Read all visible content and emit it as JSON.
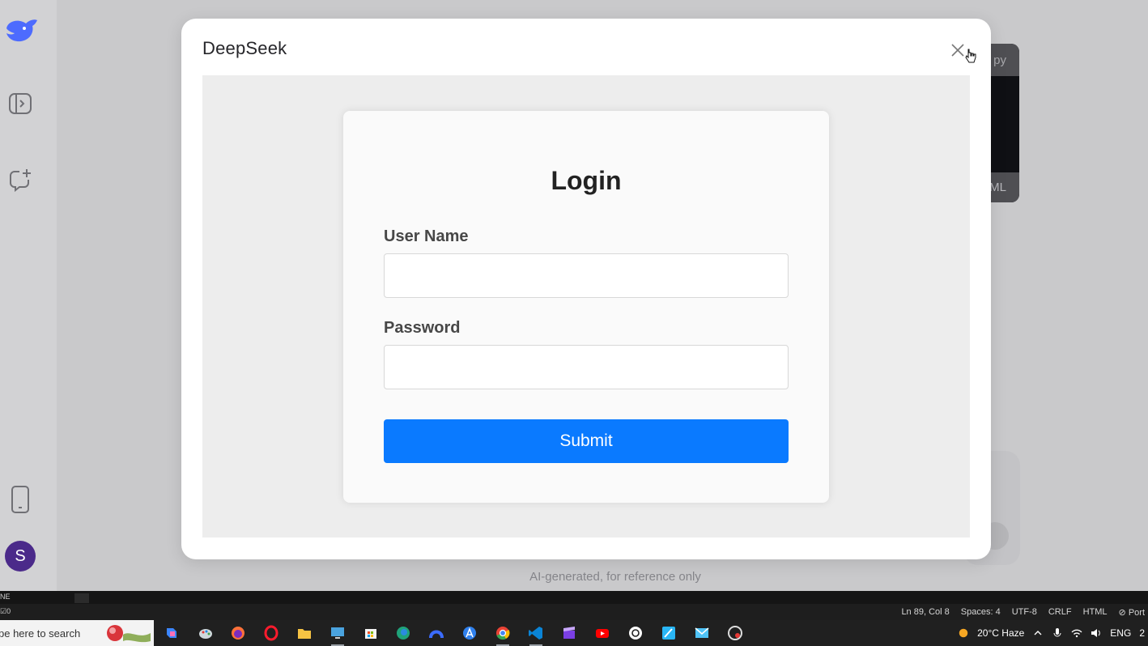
{
  "modal": {
    "title": "DeepSeek",
    "login": {
      "title": "Login",
      "username_label": "User Name",
      "username_value": "",
      "password_label": "Password",
      "password_value": "",
      "submit_label": "Submit"
    }
  },
  "background": {
    "disclaimer": "AI-generated, for reference only",
    "code_panel_head": "py",
    "code_panel_foot": "ML",
    "avatar_letter": "S"
  },
  "status_bar": {
    "left_top": "NE",
    "left_bottom": "☑0",
    "position": "Ln 89, Col 8",
    "spaces": "Spaces: 4",
    "encoding": "UTF-8",
    "eol": "CRLF",
    "language": "HTML",
    "port": "⊘ Port"
  },
  "taskbar": {
    "search_text": "pe here to search",
    "weather": "20°C  Haze",
    "language": "ENG",
    "clock_fragment": "2"
  },
  "icons": {
    "close": "close-icon",
    "cursor": "pointer-cursor-icon",
    "logo": "deepseek-whale-icon",
    "sidebar_toggle": "sidebar-toggle-icon",
    "new_chat": "new-chat-icon",
    "mobile": "mobile-phone-icon"
  },
  "colors": {
    "submit_button": "#0a7aff",
    "brand": "#4d6bfe",
    "avatar": "#4b2a8a"
  }
}
